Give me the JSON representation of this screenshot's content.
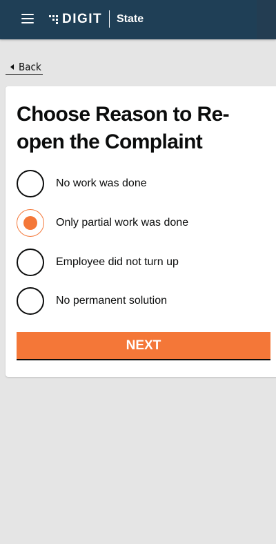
{
  "header": {
    "logo_text": "DIGIT",
    "state_label": "State"
  },
  "back": {
    "label": "Back"
  },
  "page": {
    "title": "Choose Reason to Re-open the Complaint"
  },
  "reasons": [
    {
      "label": "No work was done",
      "selected": false
    },
    {
      "label": "Only partial work was done",
      "selected": true
    },
    {
      "label": "Employee did not turn up",
      "selected": false
    },
    {
      "label": "No permanent solution",
      "selected": false
    }
  ],
  "actions": {
    "next_label": "NEXT"
  },
  "colors": {
    "header_bg": "#1f3f56",
    "accent": "#f47738",
    "page_bg": "#e5e5e5",
    "text": "#0b0c0c"
  }
}
